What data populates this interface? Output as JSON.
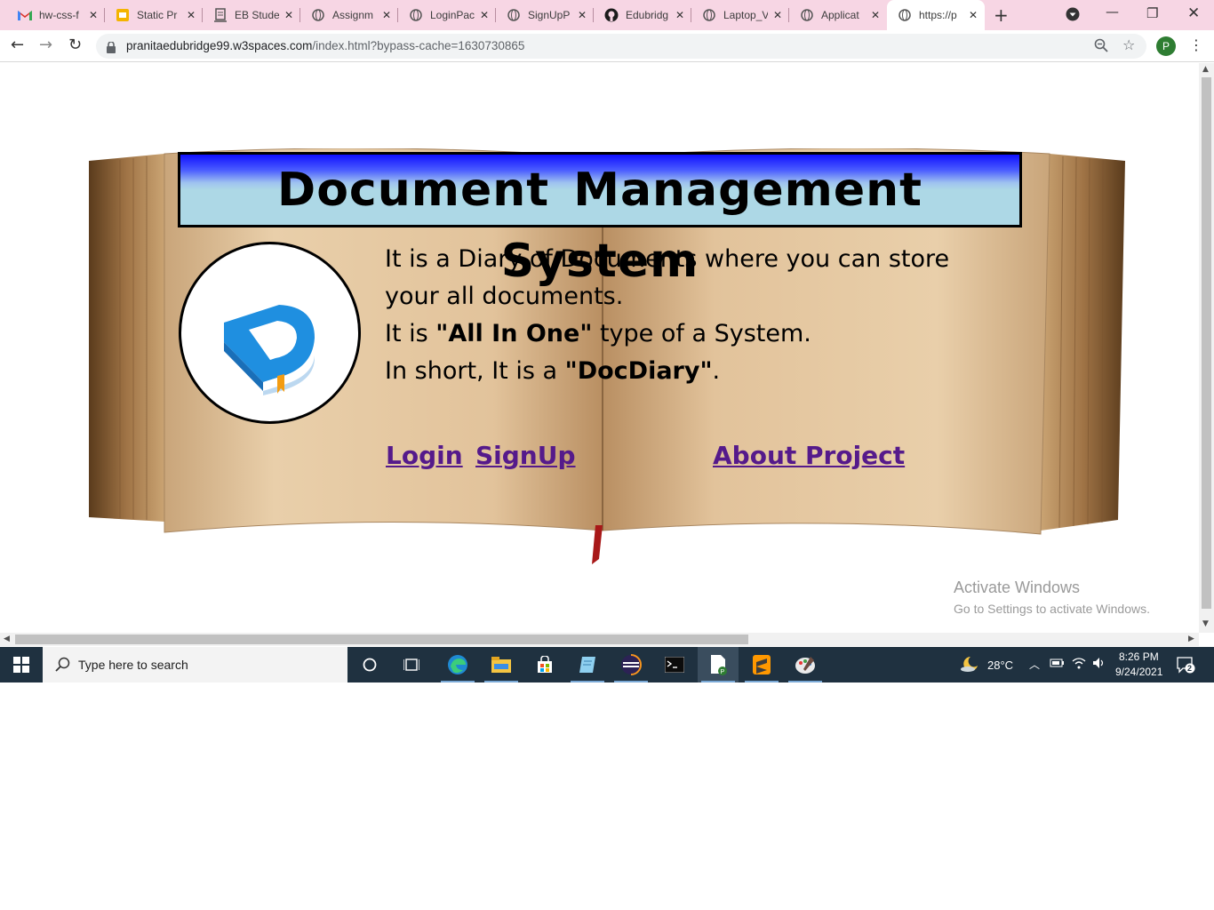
{
  "browser": {
    "tabs": [
      {
        "label": "hw-css-f",
        "icon": "gmail-icon"
      },
      {
        "label": "Static Pr",
        "icon": "slides-icon"
      },
      {
        "label": "EB Stude",
        "icon": "student-icon"
      },
      {
        "label": "Assignm",
        "icon": "globe-icon"
      },
      {
        "label": "LoginPac",
        "icon": "globe-icon"
      },
      {
        "label": "SignUpP",
        "icon": "globe-icon"
      },
      {
        "label": "Edubridg",
        "icon": "github-icon"
      },
      {
        "label": "Laptop_V",
        "icon": "globe-icon"
      },
      {
        "label": "Applicat",
        "icon": "globe-icon"
      },
      {
        "label": "https://p",
        "icon": "globe-icon",
        "active": true
      }
    ],
    "url_host": "pranitaedubridge99.w3spaces.com",
    "url_path": "/index.html?bypass-cache=1630730865",
    "profile_initial": "P"
  },
  "page": {
    "title": "Document Management System",
    "desc": {
      "line1": "It is a Diary of Documents where you can store",
      "line2": "your all documents.",
      "line3_pre": "It is ",
      "line3_bold": "\"All In One\"",
      "line3_post": " type of a System.",
      "line4_pre": "In short, It is a ",
      "line4_bold": "\"DocDiary\"",
      "line4_post": "."
    },
    "links": {
      "login": "Login",
      "signup": "SignUp",
      "about": "About Project"
    },
    "watermark": {
      "title": "Activate Windows",
      "subtitle": "Go to Settings to activate Windows."
    }
  },
  "taskbar": {
    "search_placeholder": "Type here to search",
    "weather": "28°C",
    "time": "8:26 PM",
    "date": "9/24/2021",
    "notifications": "2"
  },
  "colors": {
    "tabbar": "#f7d6e4",
    "banner_top": "#1010ff",
    "banner_bottom": "#add8e6",
    "link": "#551a8b",
    "taskbar": "#1f3140"
  }
}
